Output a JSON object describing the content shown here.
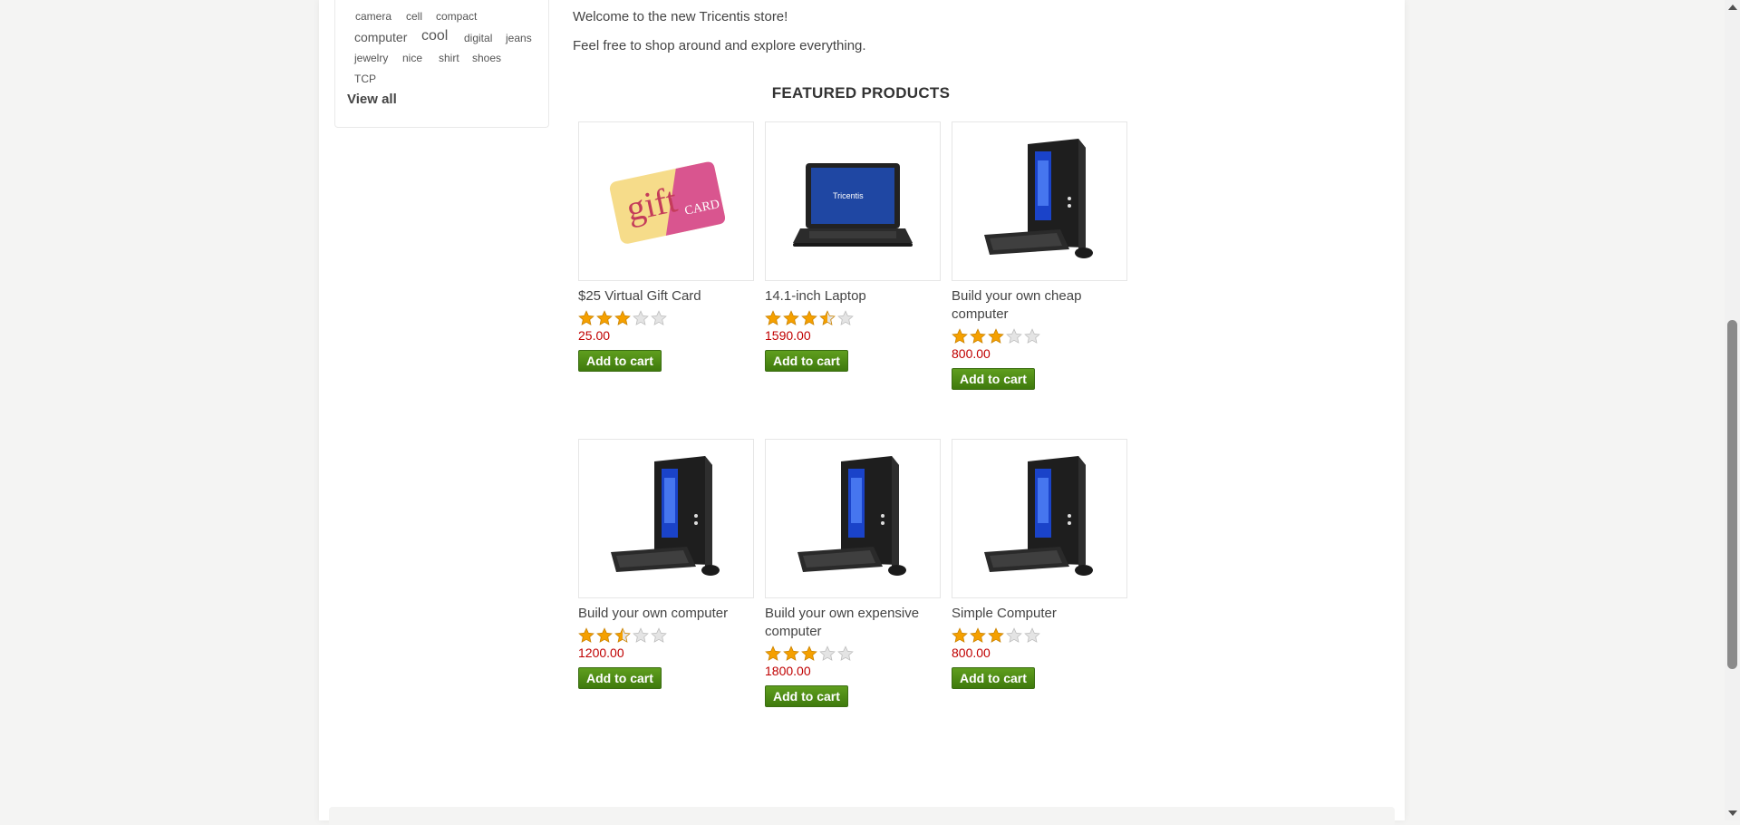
{
  "sidebar": {
    "tags": [
      {
        "label": "camera",
        "size": 12
      },
      {
        "label": "cell",
        "size": 12
      },
      {
        "label": "compact",
        "size": 12
      },
      {
        "label": "computer",
        "size": 14
      },
      {
        "label": "cool",
        "size": 16
      },
      {
        "label": "digital",
        "size": 12
      },
      {
        "label": "jeans",
        "size": 12
      },
      {
        "label": "jewelry",
        "size": 12
      },
      {
        "label": "nice",
        "size": 12
      },
      {
        "label": "shirt",
        "size": 12
      },
      {
        "label": "shoes",
        "size": 12
      },
      {
        "label": "TCP",
        "size": 12
      }
    ],
    "view_all_label": "View all"
  },
  "main": {
    "welcome_line1": "Welcome to the new Tricentis store!",
    "welcome_line2": "Feel free to shop around and explore everything.",
    "featured_title": "FEATURED PRODUCTS",
    "add_to_cart_label": "Add to cart",
    "products": [
      {
        "title": "$25 Virtual Gift Card",
        "price": "25.00",
        "rating": 3,
        "image": "gift-card"
      },
      {
        "title": "14.1-inch Laptop",
        "price": "1590.00",
        "rating": 3.5,
        "image": "laptop"
      },
      {
        "title": "Build your own cheap computer",
        "price": "800.00",
        "rating": 3,
        "image": "desktop"
      },
      {
        "title": "Build your own computer",
        "price": "1200.00",
        "rating": 2.5,
        "image": "desktop"
      },
      {
        "title": "Build your own expensive computer",
        "price": "1800.00",
        "rating": 3,
        "image": "desktop"
      },
      {
        "title": "Simple Computer",
        "price": "800.00",
        "rating": 3,
        "image": "desktop"
      }
    ],
    "laptop_screen_text": "Tricentis",
    "gift_card_text_1": "gift",
    "gift_card_text_2": "CARD"
  },
  "colors": {
    "price": "#c00000",
    "button_green": "#4a8a14",
    "star_gold": "#f5a000"
  }
}
